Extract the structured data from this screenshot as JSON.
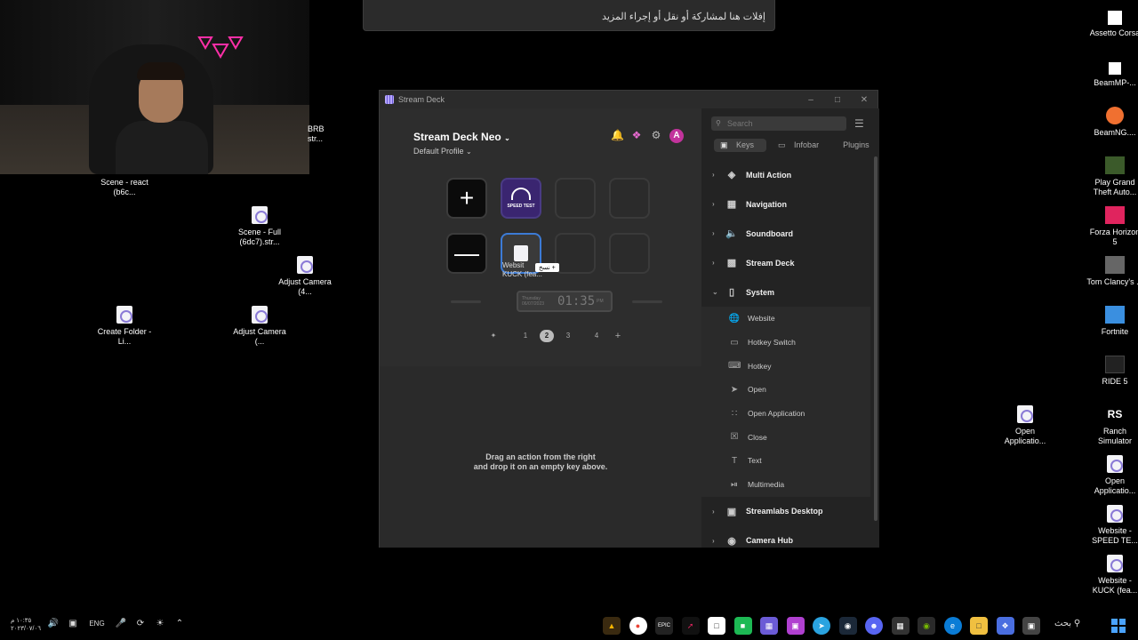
{
  "banner": {
    "text": "إفلات هنا لمشاركة أو نقل أو إجراء المزيد"
  },
  "webcam": {
    "brb_label": "BRB str..."
  },
  "desktop_left": [
    {
      "label": "Scene - react (b6c..."
    },
    {
      "label": "Scene - Full (6dc7).str..."
    },
    {
      "label": "Adjust Camera (4..."
    },
    {
      "label": "Create Folder - Li..."
    },
    {
      "label": "Adjust Camera (..."
    }
  ],
  "desktop_right": [
    {
      "label": "Assetto Corsa",
      "color": "#ffffff"
    },
    {
      "label": "BeamMP-...",
      "color": "#ffffff"
    },
    {
      "label": "BeamNG....",
      "color": "#f07030"
    },
    {
      "label": "Play Grand Theft Auto...",
      "color": "#6aa84f"
    },
    {
      "label": "Forza Horizon 5",
      "color": "#e0245e"
    },
    {
      "label": "Tom Clancy's ...",
      "color": "#cccccc"
    },
    {
      "label": "Fortnite",
      "color": "#3a8fe0"
    },
    {
      "label": "RIDE 5",
      "color": "#222222"
    },
    {
      "label": "Ranch Simulator",
      "color": "#ffffff"
    },
    {
      "label": "Open Applicatio...",
      "color": "#f3f3f7"
    },
    {
      "label": "Website - SPEED TE...",
      "color": "#f3f3f7"
    },
    {
      "label": "Website - KUCK (fea...",
      "color": "#f3f3f7"
    }
  ],
  "desktop_mid": {
    "label": "Open Applicatio..."
  },
  "window": {
    "title": "Stream Deck",
    "device_name": "Stream Deck Neo",
    "profile_name": "Default Profile",
    "avatar_letter": "A",
    "speed_test_label": "SPEED TEST",
    "key_overlay_line1": "Websit",
    "key_overlay_line2": "KUCK (fea...",
    "drag_tag": "نسخ +",
    "infobar_time": "01:35",
    "infobar_small": "Thursday 06/07/2023",
    "infobar_ampm": "PM",
    "pages": [
      "1",
      "2",
      "3",
      "4"
    ],
    "drag_hint_line1": "Drag an action from the right",
    "drag_hint_line2": "and drop it on an empty key above."
  },
  "panel": {
    "search_placeholder": "Search",
    "tabs": {
      "keys": "Keys",
      "infobar": "Infobar",
      "plugins": "Plugins"
    },
    "categories": {
      "multi_action": "Multi Action",
      "navigation": "Navigation",
      "soundboard": "Soundboard",
      "stream_deck": "Stream Deck",
      "system": "System",
      "streamlabs": "Streamlabs Desktop",
      "camera_hub": "Camera Hub"
    },
    "system_items": {
      "website": "Website",
      "hotkey_switch": "Hotkey Switch",
      "hotkey": "Hotkey",
      "open": "Open",
      "open_application": "Open Application",
      "close": "Close",
      "text": "Text",
      "multimedia": "Multimedia"
    }
  },
  "taskbar": {
    "time": "١٠:٣٥ م",
    "date": "٢٠٢٣/٠٧/٠٦",
    "lang": "ENG",
    "search_label": "بحث"
  }
}
